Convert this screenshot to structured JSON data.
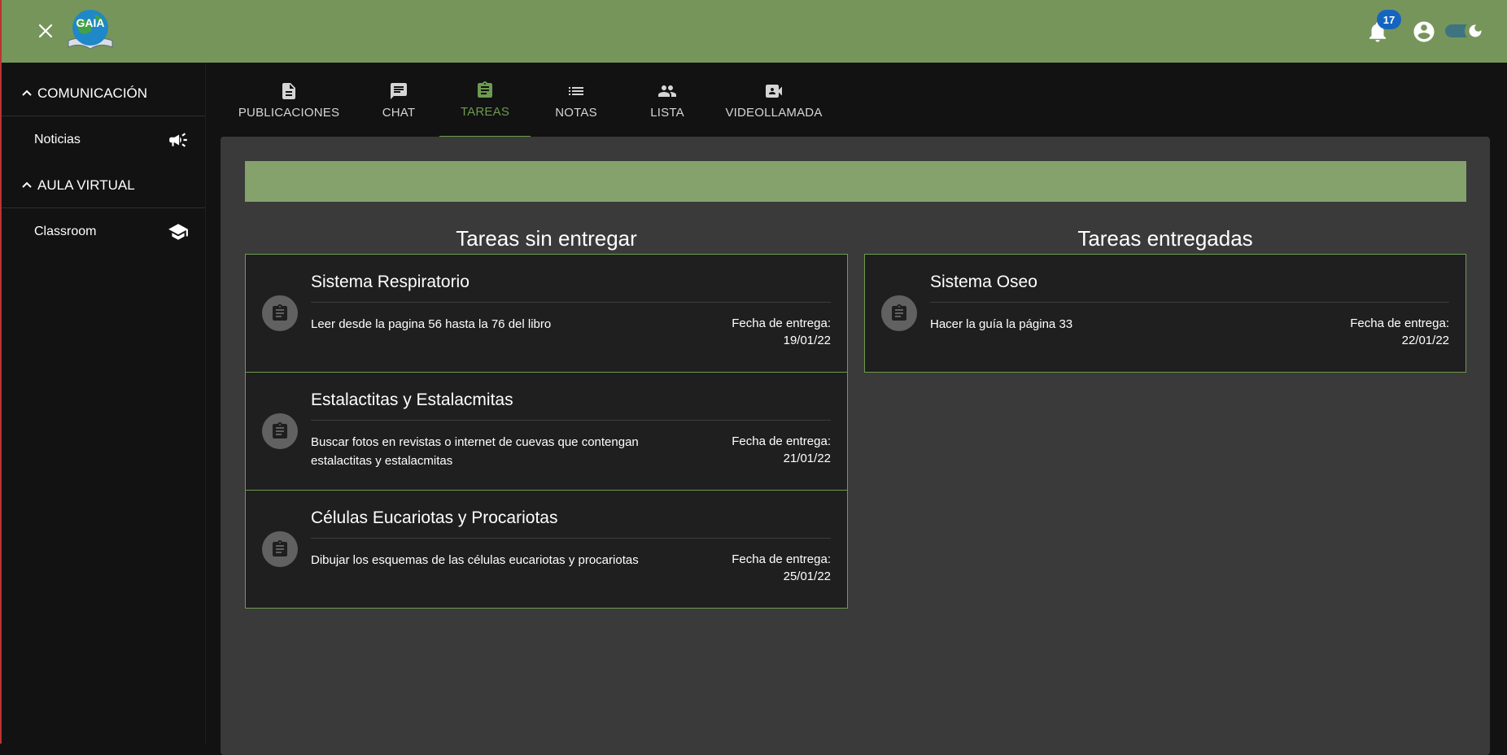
{
  "app": {
    "logo_text": "GAIA",
    "notifications_count": "17",
    "theme": "dark"
  },
  "colors": {
    "topbar": "#76955b",
    "accent": "#6c9a4e",
    "panel": "#3a3a3a",
    "card": "#1f1f1f",
    "badge": "#1565c0"
  },
  "sidebar": {
    "sections": [
      {
        "label": "COMUNICACIÓN",
        "icon": "chevron-up-icon",
        "items": [
          {
            "label": "Noticias",
            "icon": "campaign-icon"
          }
        ]
      },
      {
        "label": "AULA VIRTUAL",
        "icon": "chevron-up-icon",
        "items": [
          {
            "label": "Classroom",
            "icon": "school-icon"
          }
        ]
      }
    ]
  },
  "tabs": [
    {
      "label": "PUBLICACIONES",
      "icon": "article-icon",
      "active": false
    },
    {
      "label": "CHAT",
      "icon": "chat-icon",
      "active": false
    },
    {
      "label": "TAREAS",
      "icon": "assignment-icon",
      "active": true
    },
    {
      "label": "NOTAS",
      "icon": "list-icon",
      "active": false
    },
    {
      "label": "LISTA",
      "icon": "people-icon",
      "active": false
    },
    {
      "label": "VIDEOLLAMADA",
      "icon": "videocam-icon",
      "active": false
    }
  ],
  "pending": {
    "title": "Tareas sin entregar",
    "tasks": [
      {
        "title": "Sistema Respiratorio",
        "description": "Leer desde la pagina 56 hasta la 76 del libro",
        "due_label": "Fecha de entrega:",
        "due_date": "19/01/22"
      },
      {
        "title": "Estalactitas y Estalacmitas",
        "description": "Buscar fotos en revistas o internet de cuevas que contengan estalactitas y estalacmitas",
        "due_label": "Fecha de entrega:",
        "due_date": "21/01/22"
      },
      {
        "title": "Células Eucariotas y Procariotas",
        "description": "Dibujar los esquemas de las células eucariotas y procariotas",
        "due_label": "Fecha de entrega:",
        "due_date": "25/01/22"
      }
    ]
  },
  "delivered": {
    "title": "Tareas entregadas",
    "tasks": [
      {
        "title": "Sistema Oseo",
        "description": "Hacer la guía la página 33",
        "due_label": "Fecha de entrega:",
        "due_date": "22/01/22"
      }
    ]
  }
}
